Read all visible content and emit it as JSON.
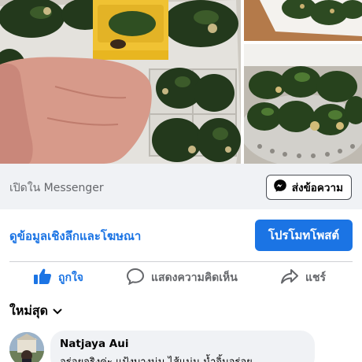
{
  "photos": {
    "main": {
      "subject": "hand holding a box of spinach dumplings in a plastic tray"
    },
    "top_right": {
      "subject": "spinach dumplings in a white dish"
    },
    "bottom_right": {
      "subject": "spinach dumplings in a steamer"
    }
  },
  "messenger": {
    "open_in_label": "เปิดใน Messenger",
    "send_button_label": "ส่งข้อความ",
    "send_icon": "messenger-icon"
  },
  "promotion": {
    "insights_link": "ดูข้อมูลเชิงลึกและโฆษณา",
    "promote_button": "โปรโมทโพสต์",
    "accent_color": "#1b74e4"
  },
  "actions": {
    "like": {
      "label": "ถูกใจ",
      "icon": "thumbs-up-icon"
    },
    "comment": {
      "label": "แสดงความคิดเห็น",
      "icon": "comment-icon"
    },
    "share": {
      "label": "แชร์",
      "icon": "share-icon"
    }
  },
  "comments": {
    "sort_label": "ใหม่สุด",
    "sort_icon": "chevron-down-icon",
    "items": [
      {
        "author": "Natjaya Aui",
        "text": "อร่อยจริงค่ะ แป้งบางนุ่ม ไส้แน่น น้ำจิ้มอร่อย"
      }
    ]
  }
}
